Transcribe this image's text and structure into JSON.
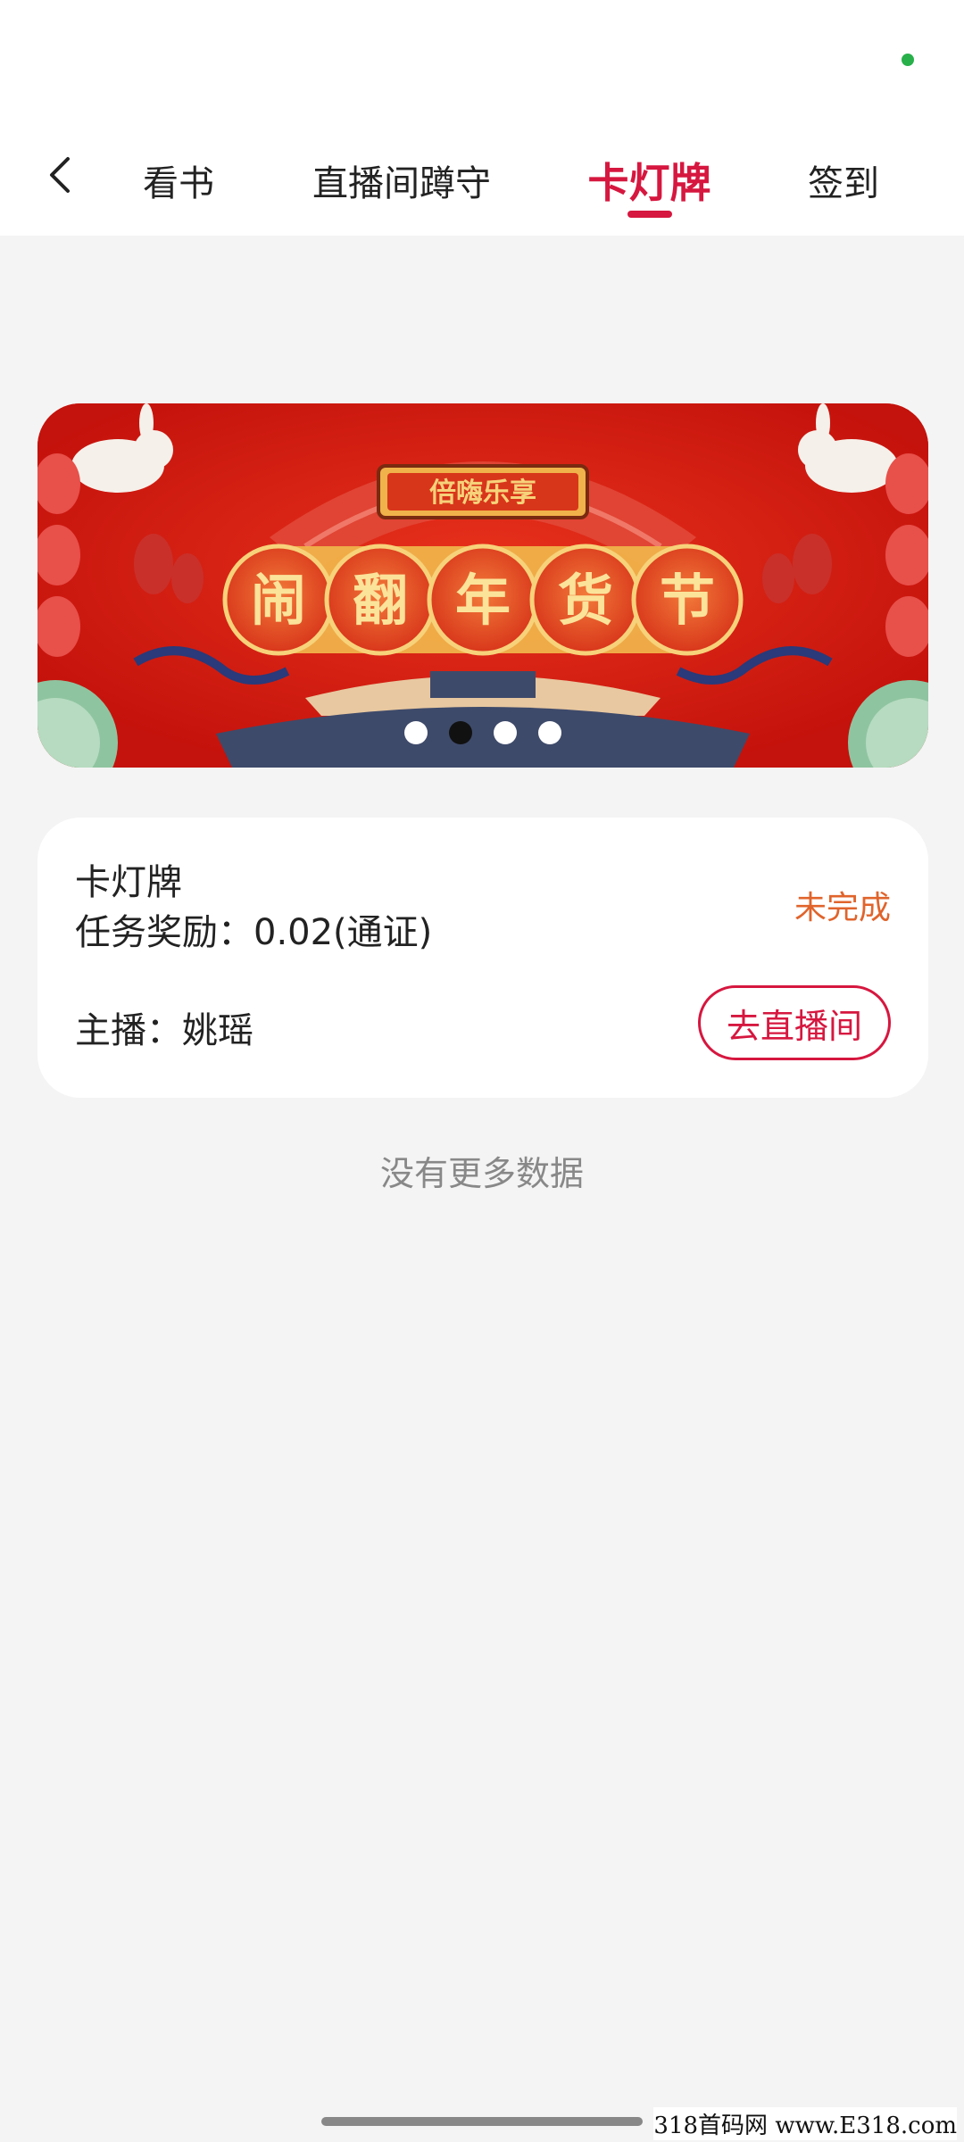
{
  "tabs": [
    {
      "label": "看书",
      "active": false
    },
    {
      "label": "直播间蹲守",
      "active": false
    },
    {
      "label": "卡灯牌",
      "active": true
    },
    {
      "label": "签到",
      "active": false
    }
  ],
  "banner": {
    "title": "闹翻年货节",
    "chars": [
      "闹",
      "翻",
      "年",
      "货",
      "节"
    ],
    "plaque": "倍嗨乐享",
    "current_slide": 2,
    "slide_count": 4
  },
  "task": {
    "title": "卡灯牌",
    "reward_label": "任务奖励：0.02(通证)",
    "status": "未完成",
    "anchor_label": "主播：姚瑶",
    "action": "去直播间"
  },
  "footer": {
    "no_more": "没有更多数据"
  },
  "watermark": "318首码网 www.E318.com",
  "colors": {
    "accent": "#d6173f",
    "status": "#e0642c",
    "banner_red": "#d21a12"
  }
}
